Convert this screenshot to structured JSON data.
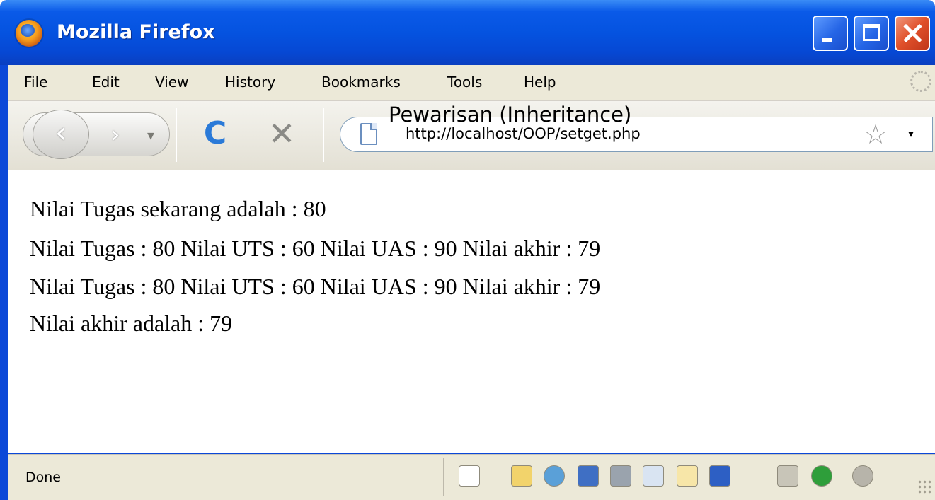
{
  "window": {
    "title": "Mozilla Firefox"
  },
  "menubar": {
    "items": [
      "File",
      "Edit",
      "View",
      "History",
      "Bookmarks",
      "Tools",
      "Help"
    ]
  },
  "toolbar": {
    "back_glyph": "‹",
    "forward_glyph": "›",
    "history_glyph": "▾",
    "reload_glyph": "C",
    "stop_glyph": "✕",
    "url": "http://localhost/OOP/setget.php",
    "star_glyph": "☆",
    "dropdown_glyph": "▾"
  },
  "overlay_title": "Pewarisan (Inheritance)",
  "content": {
    "lines": [
      "Nilai Tugas sekarang adalah : 80",
      "Nilai Tugas : 80 Nilai UTS : 60 Nilai UAS : 90 Nilai akhir : 79",
      "Nilai Tugas : 80 Nilai UTS : 60 Nilai UAS : 90 Nilai akhir : 79",
      "Nilai akhir adalah : 79"
    ]
  },
  "statusbar": {
    "text": "Done",
    "icons": [
      {
        "name": "page-info-icon",
        "color": "#ffffff"
      },
      {
        "name": "pencil-icon",
        "color": "#f2d36b"
      },
      {
        "name": "globe-icon",
        "color": "#5aa0d8"
      },
      {
        "name": "save-icon",
        "color": "#3f6fc4"
      },
      {
        "name": "print-icon",
        "color": "#9aa3ad"
      },
      {
        "name": "edit-icon",
        "color": "#d9e4f2"
      },
      {
        "name": "window-icon",
        "color": "#f7e6a8"
      },
      {
        "name": "graph-icon",
        "color": "#2d5fc4"
      },
      {
        "name": "tools-icon",
        "color": "#c8c5b8"
      },
      {
        "name": "info-icon",
        "color": "#2e9e3a"
      },
      {
        "name": "js-icon",
        "color": "#b7b4aa"
      }
    ]
  }
}
